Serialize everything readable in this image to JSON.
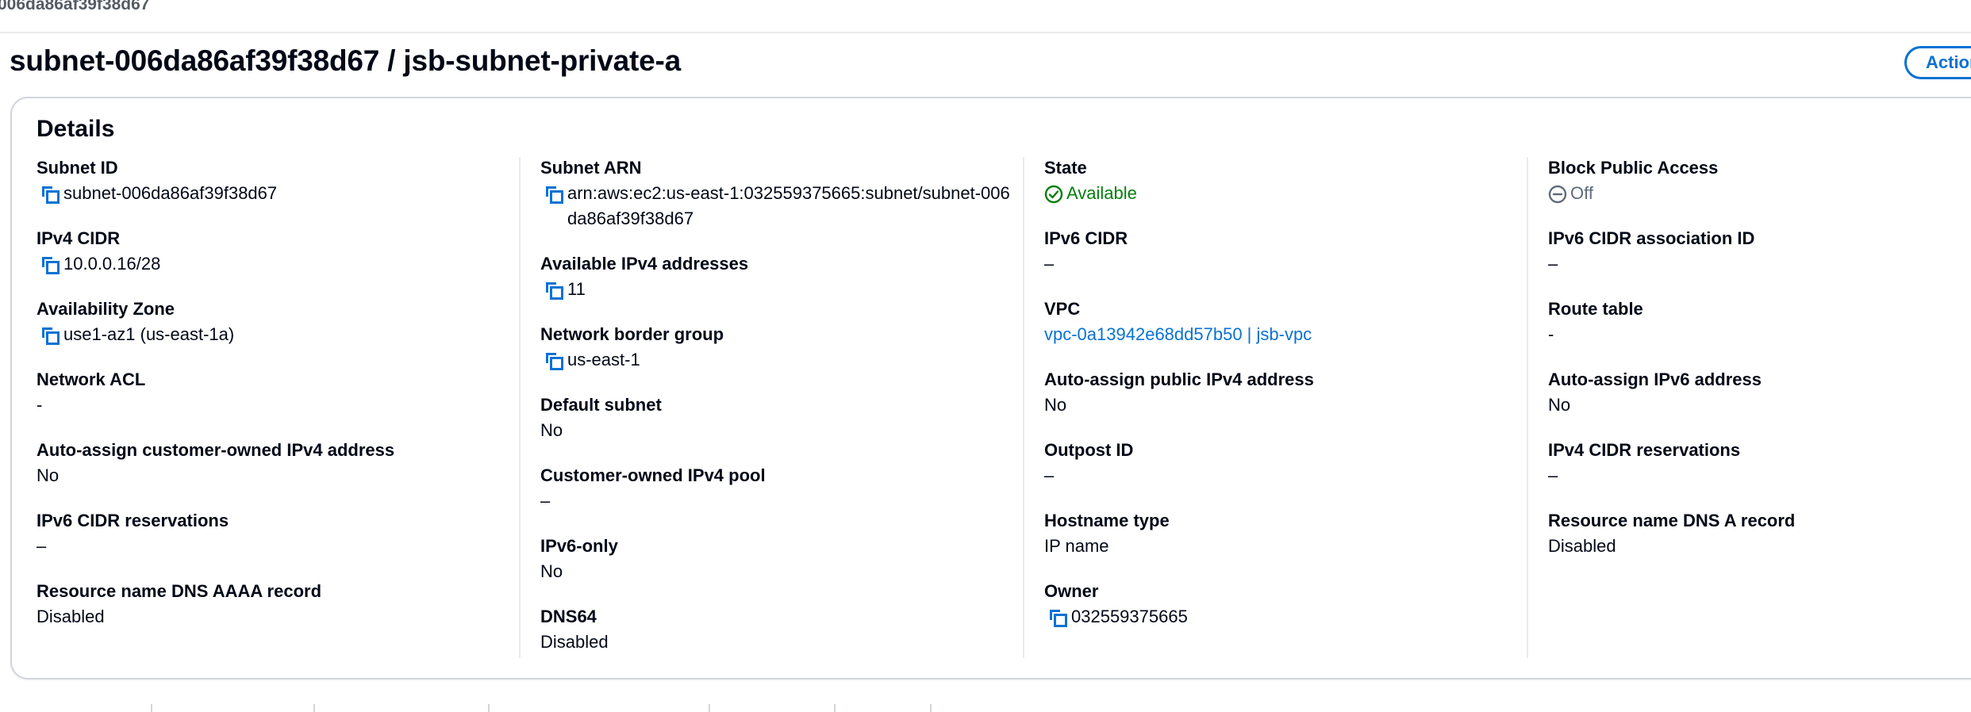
{
  "breadcrumb": {
    "current": "006da86af39f38d67"
  },
  "header": {
    "title": "subnet-006da86af39f38d67 / jsb-subnet-private-a",
    "actions_label": "Actions"
  },
  "details": {
    "heading": "Details",
    "columns": [
      [
        {
          "label": "Subnet ID",
          "value": "subnet-006da86af39f38d67",
          "copy": true
        },
        {
          "label": "IPv4 CIDR",
          "value": "10.0.0.16/28",
          "copy": true
        },
        {
          "label": "Availability Zone",
          "value": "use1-az1 (us-east-1a)",
          "copy": true
        },
        {
          "label": "Network ACL",
          "value": "-"
        },
        {
          "label": "Auto-assign customer-owned IPv4 address",
          "value": "No"
        },
        {
          "label": "IPv6 CIDR reservations",
          "value": "–"
        },
        {
          "label": "Resource name DNS AAAA record",
          "value": "Disabled"
        }
      ],
      [
        {
          "label": "Subnet ARN",
          "value": "arn:aws:ec2:us-east-1:032559375665:subnet/subnet-006da86af39f38d67",
          "copy": true
        },
        {
          "label": "Available IPv4 addresses",
          "value": "11",
          "copy": true
        },
        {
          "label": "Network border group",
          "value": "us-east-1",
          "copy": true
        },
        {
          "label": "Default subnet",
          "value": "No"
        },
        {
          "label": "Customer-owned IPv4 pool",
          "value": "–"
        },
        {
          "label": "IPv6-only",
          "value": "No"
        },
        {
          "label": "DNS64",
          "value": "Disabled"
        }
      ],
      [
        {
          "label": "State",
          "value": "Available",
          "status": "success"
        },
        {
          "label": "IPv6 CIDR",
          "value": "–"
        },
        {
          "label": "VPC",
          "value": "vpc-0a13942e68dd57b50 | jsb-vpc",
          "link": true
        },
        {
          "label": "Auto-assign public IPv4 address",
          "value": "No"
        },
        {
          "label": "Outpost ID",
          "value": "–"
        },
        {
          "label": "Hostname type",
          "value": "IP name"
        },
        {
          "label": "Owner",
          "value": "032559375665",
          "copy": true
        }
      ],
      [
        {
          "label": "Block Public Access",
          "value": "Off",
          "status": "off"
        },
        {
          "label": "IPv6 CIDR association ID",
          "value": "–"
        },
        {
          "label": "Route table",
          "value": "-"
        },
        {
          "label": "Auto-assign IPv6 address",
          "value": "No"
        },
        {
          "label": "IPv4 CIDR reservations",
          "value": "–"
        },
        {
          "label": "Resource name DNS A record",
          "value": "Disabled"
        }
      ]
    ]
  },
  "colors": {
    "link": "#0972d3",
    "success": "#037f0c",
    "muted": "#5f6b7a",
    "text": "#000716",
    "border": "#d1d5db"
  },
  "icons": {
    "copy": "copy-icon",
    "success": "status-positive-icon",
    "off": "status-stopped-icon"
  }
}
